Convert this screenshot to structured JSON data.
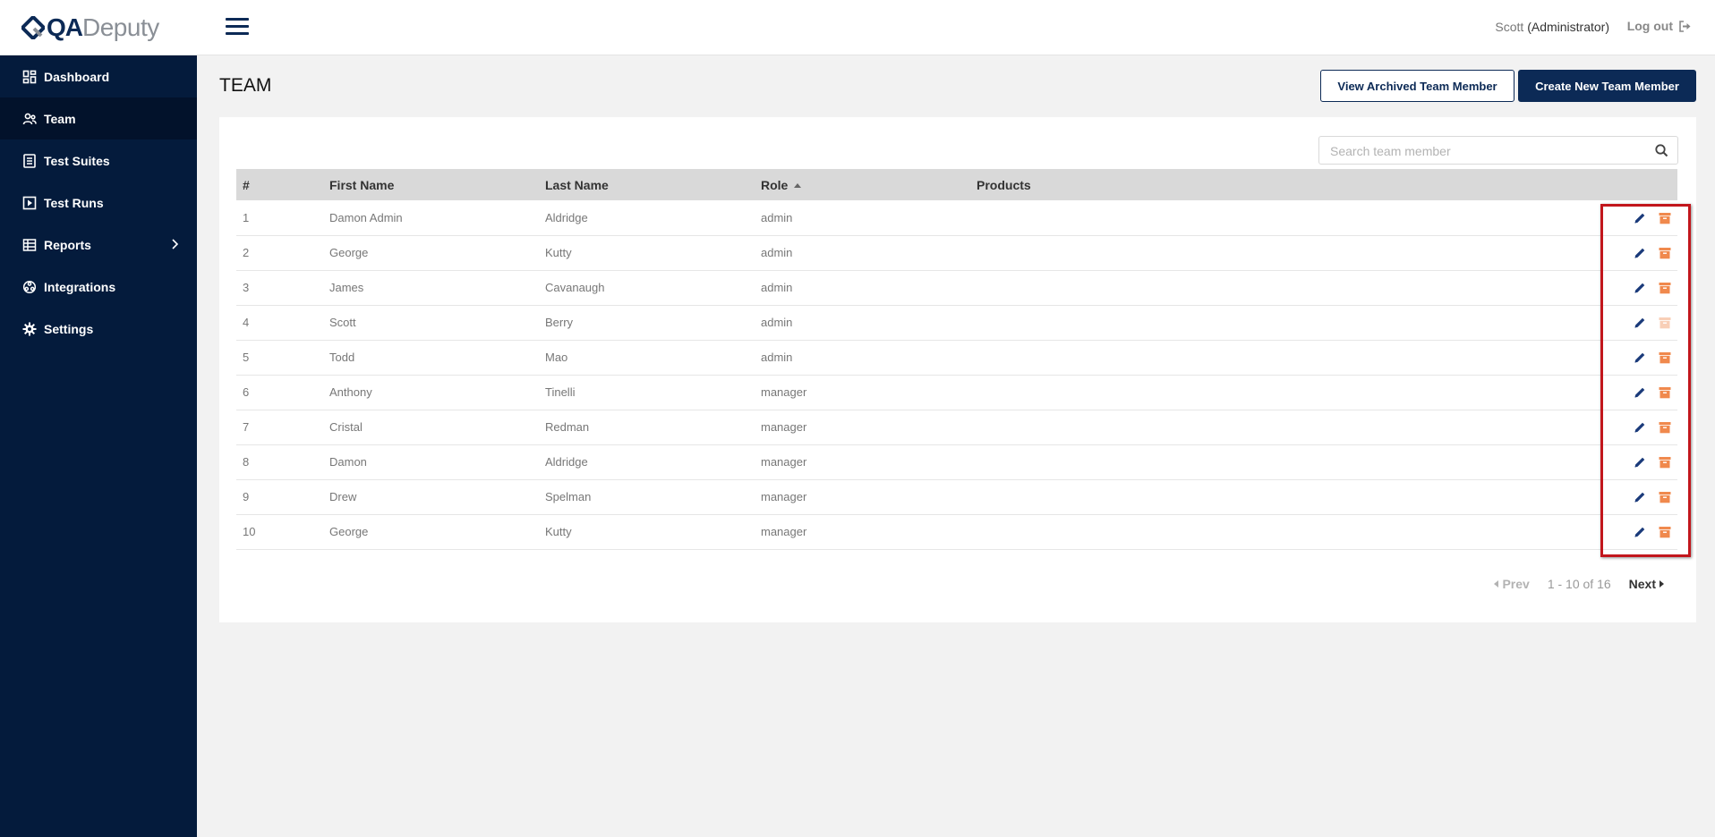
{
  "brand": {
    "logo_qa": "QA",
    "logo_deputy": "Deputy",
    "logo_icon": "qadeputy-logo-icon"
  },
  "sidebar": {
    "items": [
      {
        "label": "Dashboard",
        "icon": "dashboard-icon",
        "active": false
      },
      {
        "label": "Team",
        "icon": "team-icon",
        "active": true
      },
      {
        "label": "Test Suites",
        "icon": "test-suites-icon",
        "active": false
      },
      {
        "label": "Test Runs",
        "icon": "test-runs-icon",
        "active": false
      },
      {
        "label": "Reports",
        "icon": "reports-icon",
        "active": false,
        "has_submenu": true
      },
      {
        "label": "Integrations",
        "icon": "integrations-icon",
        "active": false
      },
      {
        "label": "Settings",
        "icon": "settings-icon",
        "active": false
      }
    ]
  },
  "header": {
    "user_name": "Scott",
    "user_role": "(Administrator)",
    "logout_label": "Log out"
  },
  "page": {
    "title": "TEAM",
    "view_archived_label": "View Archived Team Member",
    "create_new_label": "Create New Team Member"
  },
  "search": {
    "placeholder": "Search team member",
    "value": ""
  },
  "table": {
    "columns": [
      "#",
      "First Name",
      "Last Name",
      "Role",
      "Products"
    ],
    "sorted_by": "Role",
    "rows": [
      {
        "num": "1",
        "first": "Damon Admin",
        "last": "Aldridge",
        "role": "admin",
        "products": "",
        "archive_enabled": true
      },
      {
        "num": "2",
        "first": "George",
        "last": "Kutty",
        "role": "admin",
        "products": "",
        "archive_enabled": true
      },
      {
        "num": "3",
        "first": "James",
        "last": "Cavanaugh",
        "role": "admin",
        "products": "",
        "archive_enabled": true
      },
      {
        "num": "4",
        "first": "Scott",
        "last": "Berry",
        "role": "admin",
        "products": "",
        "archive_enabled": false
      },
      {
        "num": "5",
        "first": "Todd",
        "last": "Mao",
        "role": "admin",
        "products": "",
        "archive_enabled": true
      },
      {
        "num": "6",
        "first": "Anthony",
        "last": "Tinelli",
        "role": "manager",
        "products": "",
        "archive_enabled": true
      },
      {
        "num": "7",
        "first": "Cristal",
        "last": "Redman",
        "role": "manager",
        "products": "",
        "archive_enabled": true
      },
      {
        "num": "8",
        "first": "Damon",
        "last": "Aldridge",
        "role": "manager",
        "products": "",
        "archive_enabled": true
      },
      {
        "num": "9",
        "first": "Drew",
        "last": "Spelman",
        "role": "manager",
        "products": "",
        "archive_enabled": true
      },
      {
        "num": "10",
        "first": "George",
        "last": "Kutty",
        "role": "manager",
        "products": "",
        "archive_enabled": true
      }
    ]
  },
  "pagination": {
    "prev_label": "Prev",
    "info": "1 - 10 of 16",
    "next_label": "Next"
  },
  "colors": {
    "sidebar_bg": "#041b3c",
    "primary": "#0c2a56",
    "edit_icon": "#1a3a7a",
    "archive_icon": "#f0894d",
    "highlight_border": "#c2161c"
  }
}
